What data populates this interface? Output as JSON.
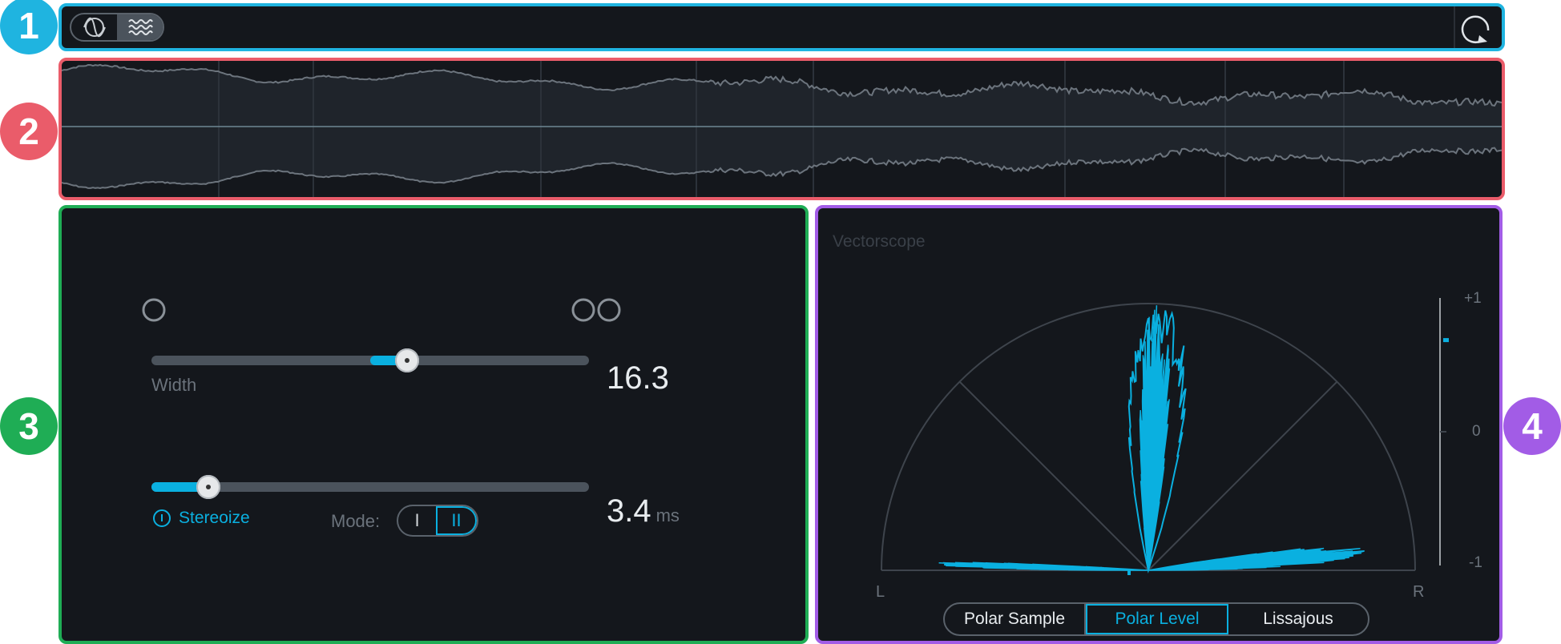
{
  "markers": [
    "1",
    "2",
    "3",
    "4"
  ],
  "toolbar": {
    "view_sine_icon": "sine-wave-icon",
    "view_noise_icon": "noise-wave-icon",
    "reset_icon": "reset-icon"
  },
  "width_panel": {
    "mono_icon": "mono-circle-icon",
    "stereo_icon": "stereo-circles-icon",
    "width_label": "Width",
    "width_value": "16.3",
    "width_level": 0.585,
    "delay_value": "3.4",
    "delay_unit": "ms",
    "delay_level": 0.13,
    "stereoize_label": "Stereoize",
    "mode_label": "Mode:",
    "mode_options": [
      "I",
      "II"
    ],
    "mode_selected": "II"
  },
  "vectorscope": {
    "title": "Vectorscope",
    "left_label": "L",
    "right_label": "R",
    "meter_top": "+1",
    "meter_mid": "0",
    "meter_bottom": "-1",
    "meter_level": 0.85,
    "tabs": [
      "Polar Sample",
      "Polar Level",
      "Lissajous"
    ],
    "selected_tab": "Polar Level"
  },
  "colors": {
    "accent": "#0ab0e0",
    "panel_bg": "#14171c",
    "marker1": "#1fb4e0",
    "marker2": "#ea5c6a",
    "marker3": "#1fad55",
    "marker4": "#a25ce6"
  }
}
